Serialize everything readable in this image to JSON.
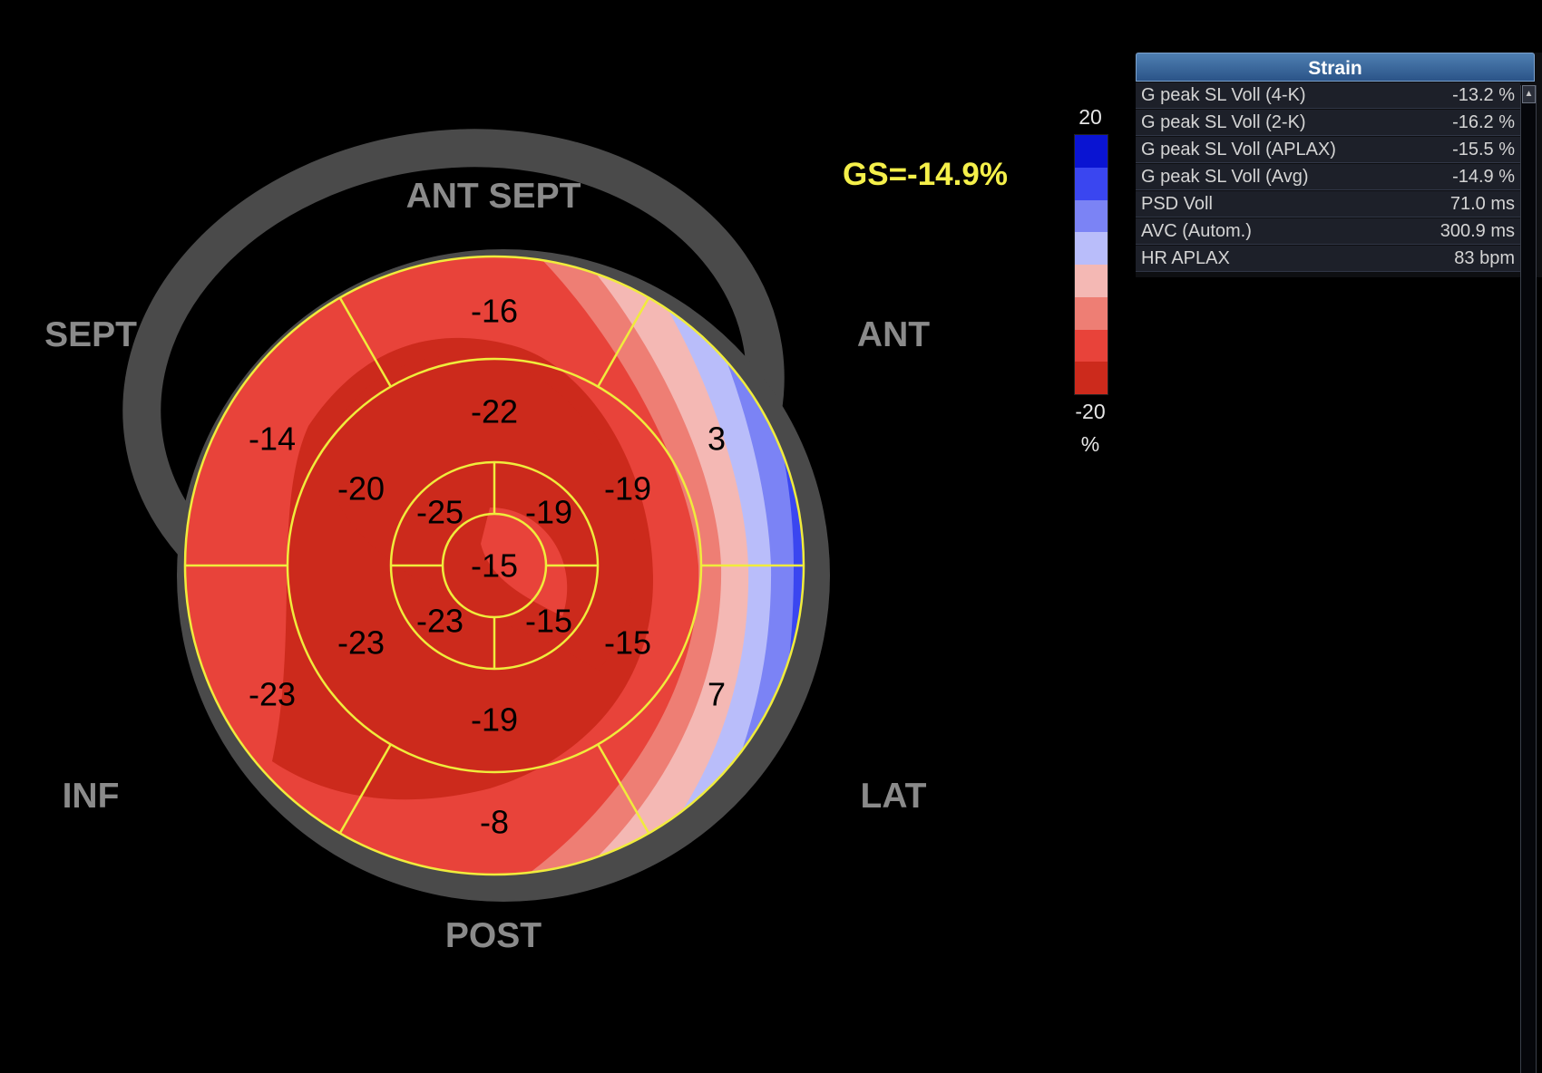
{
  "gs_label": "GS=-14.9%",
  "wall_labels": {
    "ant_sept": "ANT  SEPT",
    "sept": "SEPT",
    "ant": "ANT",
    "inf": "INF",
    "lat": "LAT",
    "post": "POST"
  },
  "segments": {
    "basal": [
      "-16",
      "3",
      "7",
      "-8",
      "-23",
      "-14"
    ],
    "mid": [
      "-22",
      "-19",
      "-15",
      "-19",
      "-23",
      "-20"
    ],
    "apical": [
      "-19",
      "-15",
      "-23",
      "-25"
    ],
    "apex": "-15"
  },
  "colorscale": {
    "max": "20",
    "min": "-20",
    "unit": "%",
    "colors": [
      "#0a14d2",
      "#3a46f0",
      "#7b83f5",
      "#b9bdfa",
      "#f4b8b4",
      "#ee7e74",
      "#e8433a",
      "#cc2a1c"
    ]
  },
  "colors": {
    "ring": "#4a4a4a",
    "grid": "#f0ec3c",
    "gs_text": "#f5f04a"
  },
  "panel": {
    "title": "Strain",
    "rows": [
      {
        "label": "G peak SL Voll (4-K)",
        "value": "-13.2 %"
      },
      {
        "label": "G peak SL Voll (2-K)",
        "value": "-16.2 %"
      },
      {
        "label": "G peak SL Voll (APLAX)",
        "value": "-15.5 %"
      },
      {
        "label": "G peak SL Voll (Avg)",
        "value": "-14.9 %"
      },
      {
        "label": "PSD Voll",
        "value": "71.0 ms"
      },
      {
        "label": "AVC (Autom.)",
        "value": "300.9 ms"
      },
      {
        "label": "HR APLAX",
        "value": "83 bpm"
      }
    ]
  }
}
